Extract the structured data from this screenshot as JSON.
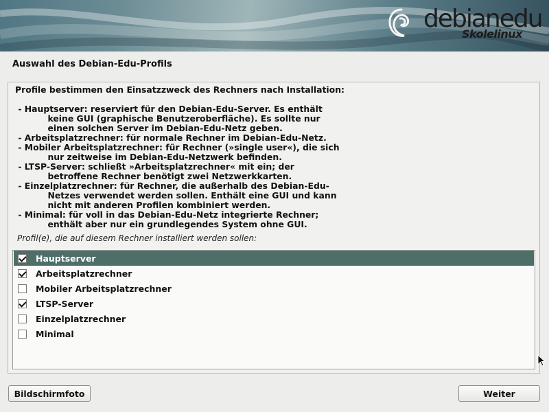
{
  "branding": {
    "logo_text": "debianedu",
    "logo_subtext": "Skolelinux"
  },
  "page": {
    "title": "Auswahl des Debian-Edu-Profils",
    "description": "Profile bestimmen den Einsatzzweck des Rechners nach Installation:\n\n - Hauptserver: reserviert für den Debian-Edu-Server. Es enthält\n           keine GUI (graphische Benutzeroberfläche). Es sollte nur\n           einen solchen Server im Debian-Edu-Netz geben.\n - Arbeitsplatzrechner: für normale Rechner im Debian-Edu-Netz.\n - Mobiler Arbeitsplatzrechner: für Rechner (»single user«), die sich\n           nur zeitweise im Debian-Edu-Netzwerk befinden.\n - LTSP-Server: schließt »Arbeitsplatzrechner« mit ein; der\n           betroffene Rechner benötigt zwei Netzwerkkarten.\n - Einzelplatzrechner: für Rechner, die außerhalb des Debian-Edu-\n           Netzes verwendet werden sollen. Enthält eine GUI und kann\n           nicht mit anderen Profilen kombiniert werden.\n - Minimal: für voll in das Debian-Edu-Netz integrierte Rechner;\n           enthält aber nur ein grundlegendes System ohne GUI.",
    "prompt": "Profil(e), die auf diesem Rechner installiert werden sollen:"
  },
  "profiles": [
    {
      "label": "Hauptserver",
      "checked": true,
      "selected": true
    },
    {
      "label": "Arbeitsplatzrechner",
      "checked": true,
      "selected": false
    },
    {
      "label": "Mobiler Arbeitsplatzrechner",
      "checked": false,
      "selected": false
    },
    {
      "label": "LTSP-Server",
      "checked": true,
      "selected": false
    },
    {
      "label": "Einzelplatzrechner",
      "checked": false,
      "selected": false
    },
    {
      "label": "Minimal",
      "checked": false,
      "selected": false
    }
  ],
  "buttons": {
    "screenshot": "Bildschirmfoto",
    "continue": "Weiter"
  },
  "colors": {
    "selection": "#4d6f68",
    "background": "#ededeb"
  }
}
